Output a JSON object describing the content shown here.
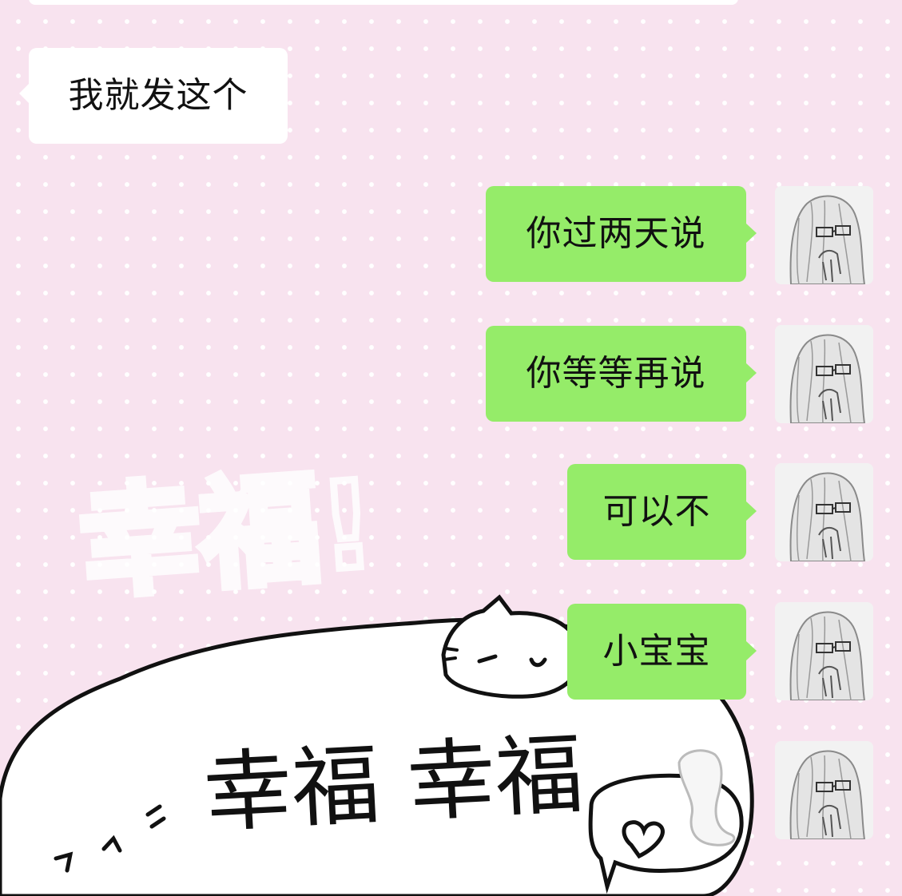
{
  "chat": {
    "messages": [
      {
        "side": "left",
        "text": "我就发这个"
      },
      {
        "side": "right",
        "text": "你过两天说"
      },
      {
        "side": "right",
        "text": "你等等再说"
      },
      {
        "side": "right",
        "text": "可以不"
      },
      {
        "side": "right",
        "text": "小宝宝"
      },
      {
        "side": "right",
        "type": "avatar-only"
      }
    ]
  },
  "wallpaper": {
    "faint_text": "幸福!",
    "big_text": "幸福 幸福",
    "colors": {
      "pink": "#f8e3ef",
      "dot": "#ffffff",
      "outline": "#111111"
    }
  },
  "colors": {
    "outgoing_bubble": "#95ec69",
    "incoming_bubble": "#ffffff",
    "text": "#111111"
  },
  "avatar": {
    "icon": "manga-girl-glasses-avatar"
  }
}
